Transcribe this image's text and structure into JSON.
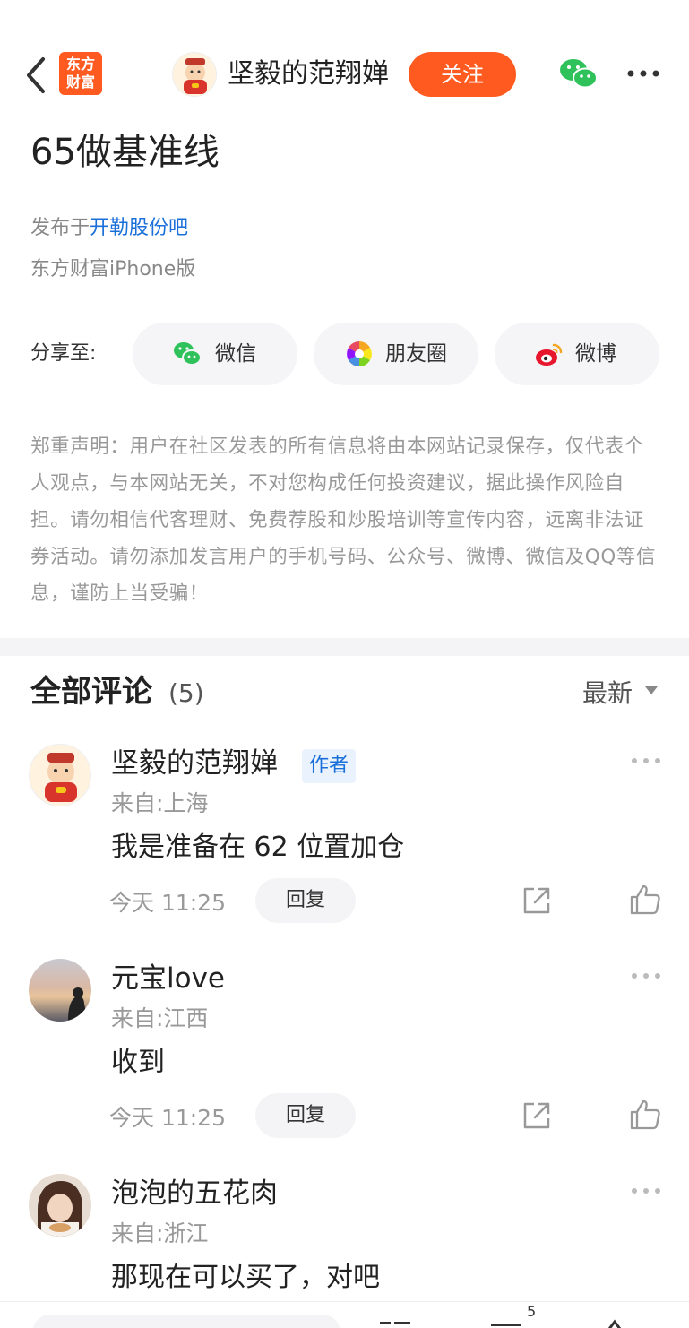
{
  "header": {
    "logo_text": "东方\n财富",
    "author_name": "坚毅的范翔婵",
    "follow_label": "关注",
    "icons": [
      "back-chevron-icon",
      "wechat-icon",
      "more-dots-icon"
    ]
  },
  "post": {
    "title": "65做基准线",
    "posted_in_prefix": "发布于",
    "forum_name": "开勒股份吧",
    "device": "东方财富iPhone版"
  },
  "share": {
    "label": "分享至:",
    "buttons": [
      {
        "label": "微信",
        "icon": "wechat-icon"
      },
      {
        "label": "朋友圈",
        "icon": "moments-icon"
      },
      {
        "label": "微博",
        "icon": "weibo-icon"
      }
    ]
  },
  "disclaimer": "郑重声明：用户在社区发表的所有信息将由本网站记录保存，仅代表个人观点，与本网站无关，不对您构成任何投资建议，据此操作风险自担。请勿相信代客理财、免费荐股和炒股培训等宣传内容，远离非法证券活动。请勿添加发言用户的手机号码、公众号、微博、微信及QQ等信息，谨防上当受骗！",
  "comments_section": {
    "title": "全部评论",
    "count": "(5)",
    "sort_label": "最新",
    "items": [
      {
        "name": "坚毅的范翔婵",
        "tag": "作者",
        "location": "来自:上海",
        "text": "我是准备在 62 位置加仓",
        "time": "今天 11:25",
        "reply_label": "回复"
      },
      {
        "name": "元宝love",
        "location": "来自:江西",
        "text": "收到",
        "time": "今天 11:25",
        "reply_label": "回复"
      },
      {
        "name": "泡泡的五花肉",
        "location": "来自:浙江",
        "text": "那现在可以买了，对吧"
      }
    ]
  },
  "bottom_bar": {
    "comment_badge": "5"
  },
  "colors": {
    "brand_orange": "#ff5a1f",
    "link_blue": "#1a6fd9",
    "wechat_green": "#2fc25b",
    "weibo_red": "#e6162d"
  }
}
